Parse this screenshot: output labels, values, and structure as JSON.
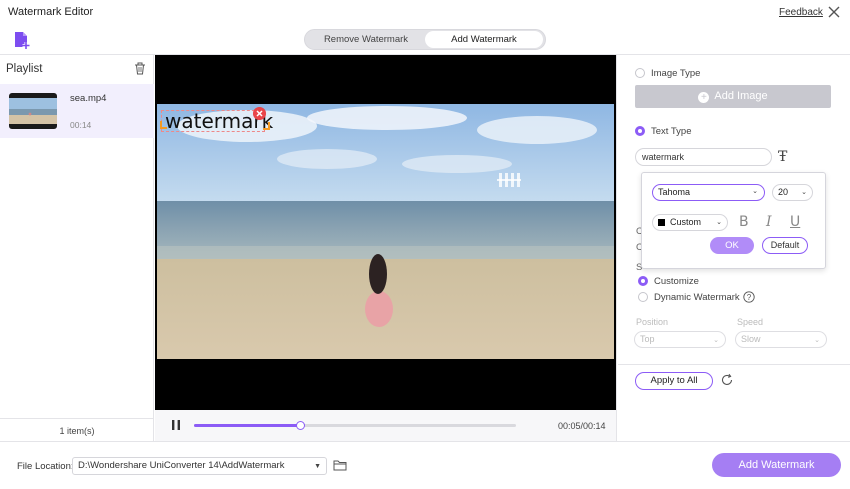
{
  "window": {
    "title": "Watermark Editor",
    "feedback_label": "Feedback"
  },
  "icons": {
    "close": "close-icon",
    "add_file": "add-file-icon",
    "trash": "trash-icon",
    "pause": "pause-icon",
    "font": "font-icon",
    "refresh": "refresh-icon",
    "folder": "folder-icon",
    "help": "help-icon",
    "plus": "plus-icon"
  },
  "mode_toggle": {
    "remove_label": "Remove Watermark",
    "add_label": "Add Watermark",
    "selected": "Add Watermark"
  },
  "playlist": {
    "title": "Playlist",
    "items": [
      {
        "name": "sea.mp4",
        "duration": "00:14"
      }
    ],
    "count_label": "1 item(s)"
  },
  "preview": {
    "watermark_text": "watermark"
  },
  "player": {
    "time": "00:05/00:14",
    "progress": 0.33
  },
  "panel": {
    "image_type_label": "Image Type",
    "add_image_label": "Add Image",
    "text_type_label": "Text Type",
    "watermark_text_value": "watermark",
    "font_popup": {
      "font": "Tahoma",
      "size": "20",
      "color_label": "Custom",
      "color_value": "#000000",
      "bold": "B",
      "italic": "I",
      "underline": "U",
      "ok_label": "OK",
      "default_label": "Default"
    },
    "customize_label": "Customize",
    "dynamic_label": "Dynamic Watermark",
    "position_label": "Position",
    "position_value": "Top",
    "speed_label": "Speed",
    "speed_value": "Slow",
    "apply_all_label": "Apply to All"
  },
  "footer": {
    "file_location_label": "File Location:",
    "file_location_value": "D:\\Wondershare UniConverter 14\\AddWatermark",
    "add_watermark_label": "Add Watermark"
  },
  "colors": {
    "accent": "#8c5cf6",
    "accent_light": "#a57ef3",
    "video_bg": "#000000"
  }
}
